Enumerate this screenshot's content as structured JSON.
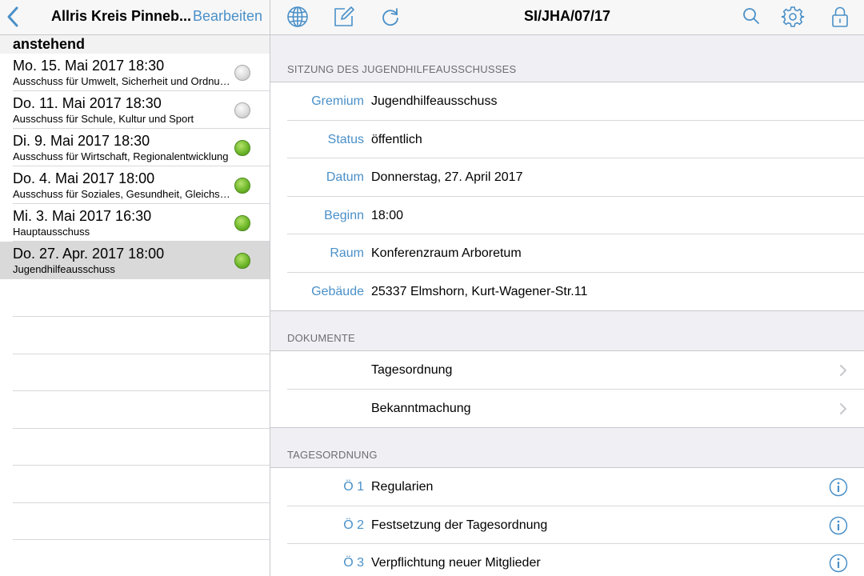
{
  "left": {
    "nav_title": "Allris Kreis Pinneb...",
    "edit_label": "Bearbeiten",
    "section": "anstehend",
    "meetings": [
      {
        "date": "Mo. 15. Mai 2017 18:30",
        "name": "Ausschuss für Umwelt, Sicherheit und Ordnung",
        "status": "grey"
      },
      {
        "date": "Do. 11. Mai 2017 18:30",
        "name": "Ausschuss für Schule, Kultur und Sport",
        "status": "grey"
      },
      {
        "date": "Di. 9. Mai 2017 18:30",
        "name": "Ausschuss für Wirtschaft, Regionalentwicklung",
        "status": "green"
      },
      {
        "date": "Do. 4. Mai 2017 18:00",
        "name": "Ausschuss für Soziales, Gesundheit, Gleichstellung",
        "status": "green"
      },
      {
        "date": "Mi. 3. Mai 2017 16:30",
        "name": "Hauptausschuss",
        "status": "green"
      },
      {
        "date": "Do. 27. Apr. 2017 18:00",
        "name": "Jugendhilfeausschuss",
        "status": "green",
        "selected": true
      }
    ]
  },
  "right": {
    "nav_title": "SI/JHA/07/17",
    "icons": [
      "globe-icon",
      "compose-icon",
      "refresh-icon",
      "search-icon",
      "gear-icon",
      "lock-icon"
    ],
    "details_header": "SITZUNG DES JUGENDHILFEAUSSCHUSSES",
    "details": [
      {
        "label": "Gremium",
        "value": "Jugendhilfeausschuss"
      },
      {
        "label": "Status",
        "value": "öffentlich"
      },
      {
        "label": "Datum",
        "value": "Donnerstag, 27. April 2017"
      },
      {
        "label": "Beginn",
        "value": "18:00"
      },
      {
        "label": "Raum",
        "value": "Konferenzraum Arboretum"
      },
      {
        "label": "Gebäude",
        "value": "25337 Elmshorn, Kurt-Wagener-Str.11"
      }
    ],
    "documents_header": "DOKUMENTE",
    "documents": [
      {
        "value": "Tagesordnung"
      },
      {
        "value": "Bekanntmachung"
      }
    ],
    "agenda_header": "TAGESORDNUNG",
    "agenda": [
      {
        "label": "Ö 1",
        "value": "Regularien"
      },
      {
        "label": "Ö 2",
        "value": "Festsetzung der Tagesordnung"
      },
      {
        "label": "Ö 3",
        "value": "Verpflichtung neuer Mitglieder"
      }
    ]
  },
  "colors": {
    "accent": "#4a90c8",
    "status_green": "#6fb82b",
    "status_grey": "#d0d0d0"
  }
}
